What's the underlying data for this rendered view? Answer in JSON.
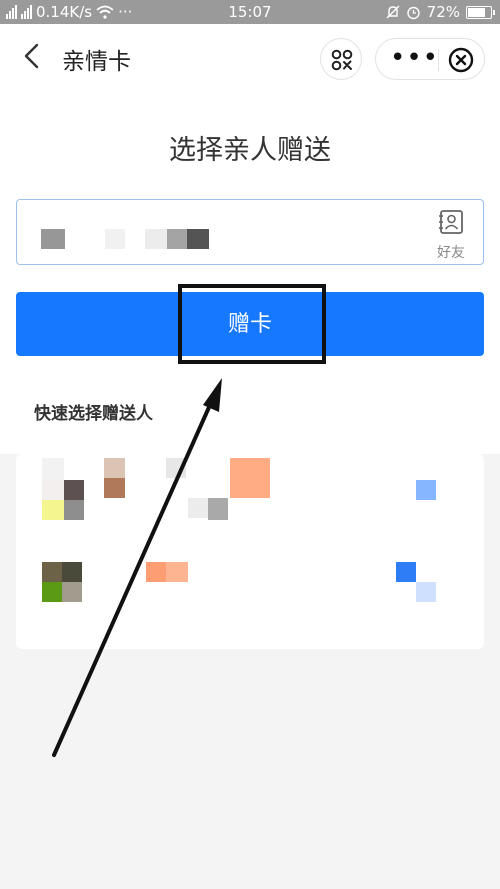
{
  "status_bar": {
    "network": "0.14K/s",
    "dots": "···",
    "time": "15:07",
    "battery": "72%"
  },
  "nav": {
    "title": "亲情卡",
    "more": "•••"
  },
  "heading": "选择亲人赠送",
  "input": {
    "friends_label": "好友"
  },
  "give_button": "赠卡",
  "quick_select_title": "快速选择赠送人",
  "colors": {
    "primary_blue": "#1677ff",
    "input_border": "#9cc0f0"
  }
}
